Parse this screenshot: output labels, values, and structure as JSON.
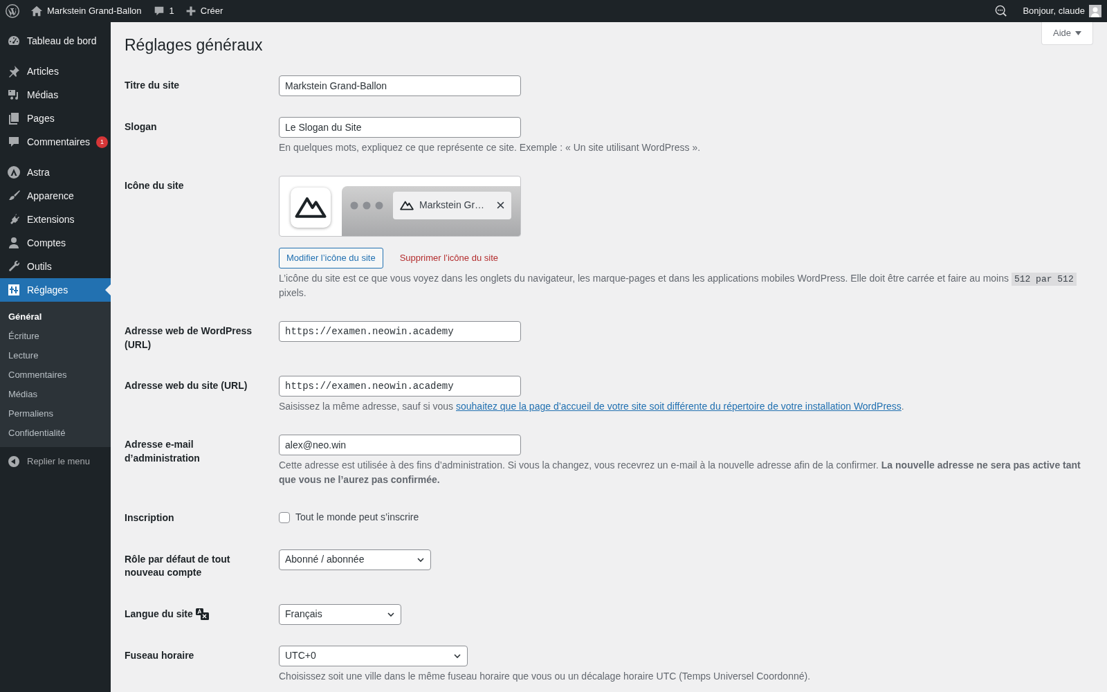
{
  "admin_bar": {
    "site_name": "Markstein Grand-Ballon",
    "comments_count": "1",
    "new_label": "Créer",
    "greeting": "Bonjour, claude"
  },
  "help_tab": "Aide",
  "menu": {
    "groups": [
      [
        {
          "label": "Tableau de bord",
          "selected": false
        }
      ],
      [
        {
          "label": "Articles",
          "selected": false
        },
        {
          "label": "Médias",
          "selected": false
        },
        {
          "label": "Pages",
          "selected": false
        },
        {
          "label": "Commentaires",
          "selected": false,
          "badge": "1"
        }
      ],
      [
        {
          "label": "Astra",
          "selected": false
        },
        {
          "label": "Apparence",
          "selected": false
        },
        {
          "label": "Extensions",
          "selected": false
        },
        {
          "label": "Comptes",
          "selected": false
        },
        {
          "label": "Outils",
          "selected": false
        },
        {
          "label": "Réglages",
          "selected": true
        }
      ]
    ],
    "submenu": [
      {
        "label": "Général",
        "selected": true
      },
      {
        "label": "Écriture",
        "selected": false
      },
      {
        "label": "Lecture",
        "selected": false
      },
      {
        "label": "Commentaires",
        "selected": false
      },
      {
        "label": "Médias",
        "selected": false
      },
      {
        "label": "Permaliens",
        "selected": false
      },
      {
        "label": "Confidentialité",
        "selected": false
      }
    ],
    "collapse": "Replier le menu"
  },
  "page_title": "Réglages généraux",
  "fields": [
    {
      "kind": "text",
      "label": "Titre du site",
      "value": "Markstein Grand-Ballon"
    },
    {
      "kind": "text",
      "label": "Slogan",
      "value": "Le Slogan du Site",
      "description": [
        {
          "kind": "text",
          "text": "En quelques mots, expliquez ce que représente ce site. Exemple : « Un site utilisant WordPress »."
        }
      ]
    },
    {
      "kind": "site_icon",
      "label": "Icône du site",
      "tab_title": "Markstein Gr…",
      "buttons": [
        "Modifier l’icône du site",
        "Supprimer l’icône du site"
      ],
      "description": [
        {
          "kind": "text",
          "text": "L’icône du site est ce que vous voyez dans les onglets du navigateur, les marque-pages et dans les applications mobiles WordPress. Elle doit être carrée et faire au moins "
        },
        {
          "kind": "code",
          "text": "512 par 512"
        },
        {
          "kind": "text",
          "text": " pixels."
        }
      ]
    },
    {
      "kind": "url",
      "label": "Adresse web de WordPress (URL)",
      "value": "https://examen.neowin.academy"
    },
    {
      "kind": "url",
      "label": "Adresse web du site (URL)",
      "value": "https://examen.neowin.academy",
      "description": [
        {
          "kind": "text",
          "text": "Saisissez la même adresse, sauf si vous "
        },
        {
          "kind": "link",
          "text": "souhaitez que la page d’accueil de votre site soit différente du répertoire de votre installation WordPress"
        },
        {
          "kind": "text",
          "text": "."
        }
      ]
    },
    {
      "kind": "text",
      "label": "Adresse e-mail d’administration",
      "value": "alex@neo.win",
      "description": [
        {
          "kind": "text",
          "text": "Cette adresse est utilisée à des fins d’administration. Si vous la changez, vous recevrez un e-mail à la nouvelle adresse afin de la confirmer. **La nouvelle adresse ne sera pas active tant que vous ne l’aurez pas confirmée.**"
        }
      ]
    },
    {
      "kind": "checkbox",
      "label": "Inscription",
      "checkbox_label": "Tout le monde peut s’inscrire",
      "checked": false
    },
    {
      "kind": "select",
      "label": "Rôle par défaut de tout nouveau compte",
      "value": "Abonné / abonnée"
    },
    {
      "kind": "language",
      "label": "Langue du site",
      "value": "Français"
    },
    {
      "kind": "select",
      "label": "Fuseau horaire",
      "value": "UTC+0",
      "description": [
        {
          "kind": "text",
          "text": "Choisissez soit une ville dans le même fuseau horaire que vous ou un décalage horaire UTC (Temps Universel Coordonné)."
        }
      ]
    }
  ]
}
